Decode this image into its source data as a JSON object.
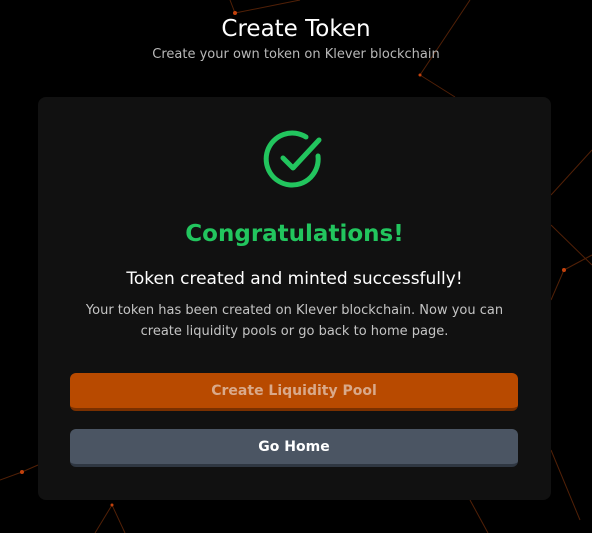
{
  "header": {
    "title": "Create Token",
    "subtitle": "Create your own token on Klever blockchain"
  },
  "result": {
    "icon": "check-circle-icon",
    "headline": "Congratulations!",
    "message": "Token created and minted successfully!",
    "description": "Your token has been created on Klever blockchain. Now you can create liquidity pools or go back to home page."
  },
  "actions": {
    "primary_label": "Create Liquidity Pool",
    "secondary_label": "Go Home"
  },
  "colors": {
    "success": "#22c55e",
    "primary_button": "#b84a00",
    "secondary_button": "#4b5563",
    "card": "#111111",
    "background": "#000000",
    "network_accent": "#c2410c"
  }
}
